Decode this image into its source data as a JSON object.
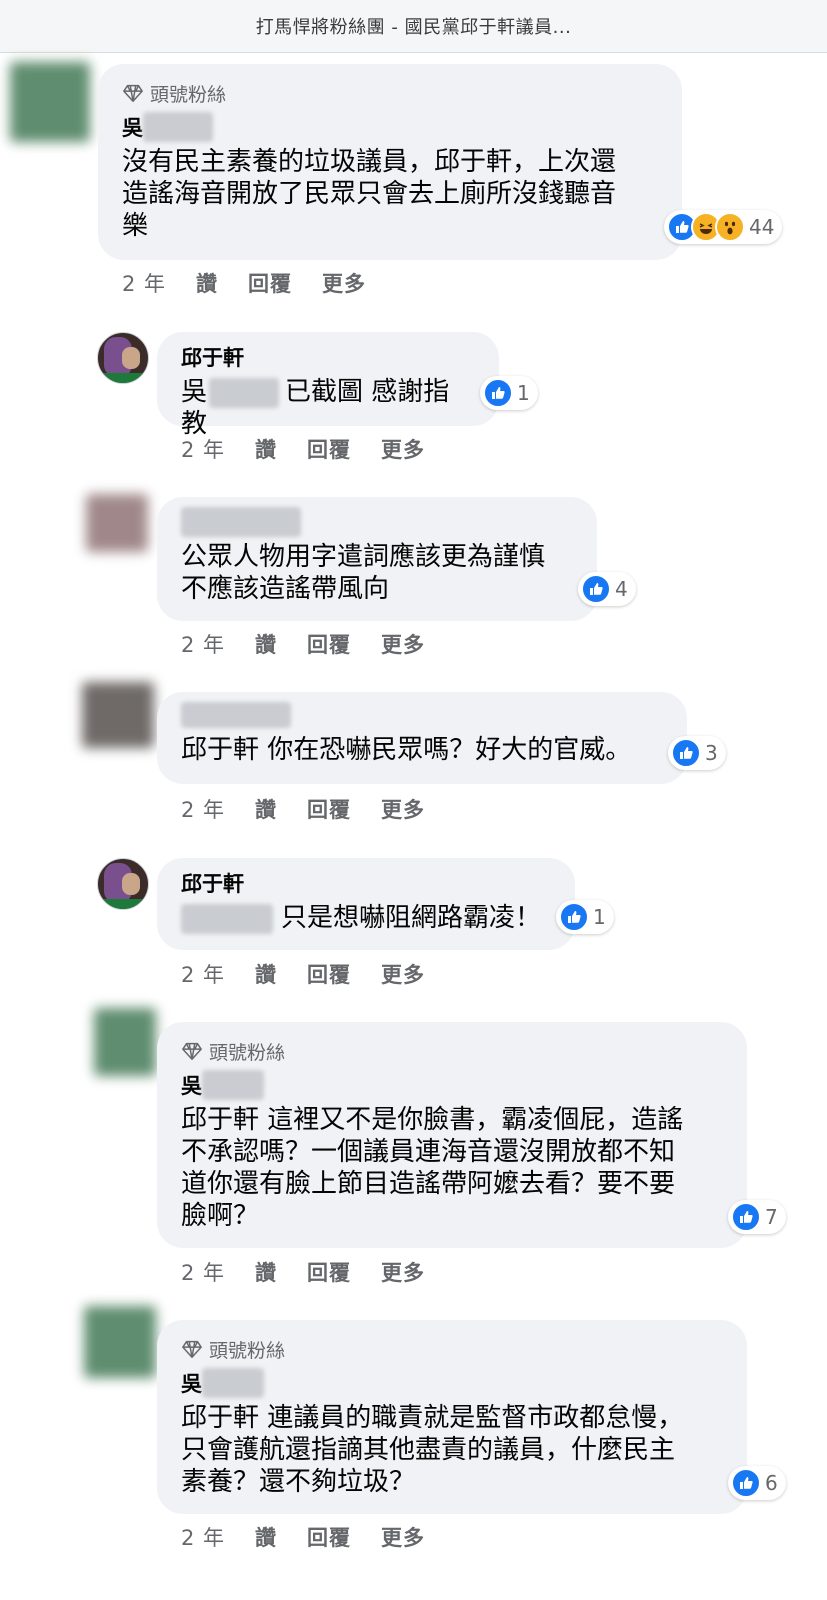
{
  "header": {
    "title": "打馬悍將粉絲團 - 國民黨邱于軒議員..."
  },
  "actions": {
    "time": "2 年",
    "like": "讚",
    "reply": "回覆",
    "more": "更多"
  },
  "badge_label": "頭號粉絲",
  "comments": [
    {
      "author_visible": "吳",
      "text_lines": [
        "沒有民主素養的垃圾議員，邱于軒，上次還",
        "造謠海音開放了民眾只會去上廁所沒錢聽音",
        "樂"
      ],
      "reaction_count": "44",
      "reactions": [
        "like-icon",
        "haha-icon",
        "wow-icon"
      ]
    },
    {
      "author": "邱于軒",
      "text_prefix": "吳",
      "text_suffix": "已截圖 感謝指教",
      "reaction_count": "1",
      "reactions": [
        "like-icon"
      ]
    },
    {
      "text_lines": [
        "公眾人物用字遣詞應該更為謹慎",
        "不應該造謠帶風向"
      ],
      "reaction_count": "4",
      "reactions": [
        "like-icon"
      ]
    },
    {
      "text_lines": [
        "邱于軒 你在恐嚇民眾嗎？好大的官威。"
      ],
      "reaction_count": "3",
      "reactions": [
        "like-icon"
      ]
    },
    {
      "author": "邱于軒",
      "text_suffix": "只是想嚇阻網路霸凌！",
      "reaction_count": "1",
      "reactions": [
        "like-icon"
      ]
    },
    {
      "author_visible": "吳",
      "text_lines": [
        "邱于軒 這裡又不是你臉書，霸凌個屁，造謠",
        "不承認嗎？一個議員連海音還沒開放都不知",
        "道你還有臉上節目造謠帶阿嬤去看？要不要",
        "臉啊？"
      ],
      "reaction_count": "7",
      "reactions": [
        "like-icon"
      ]
    },
    {
      "author_visible": "吳",
      "text_lines": [
        "邱于軒 連議員的職責就是監督市政都怠慢，",
        "只會護航還指謫其他盡責的議員，什麼民主",
        "素養？還不夠垃圾？"
      ],
      "reaction_count": "6",
      "reactions": [
        "like-icon"
      ]
    }
  ],
  "colors": {
    "bubble": "#f0f2f5",
    "like": "#1877f2",
    "meta_text": "#65676b"
  }
}
